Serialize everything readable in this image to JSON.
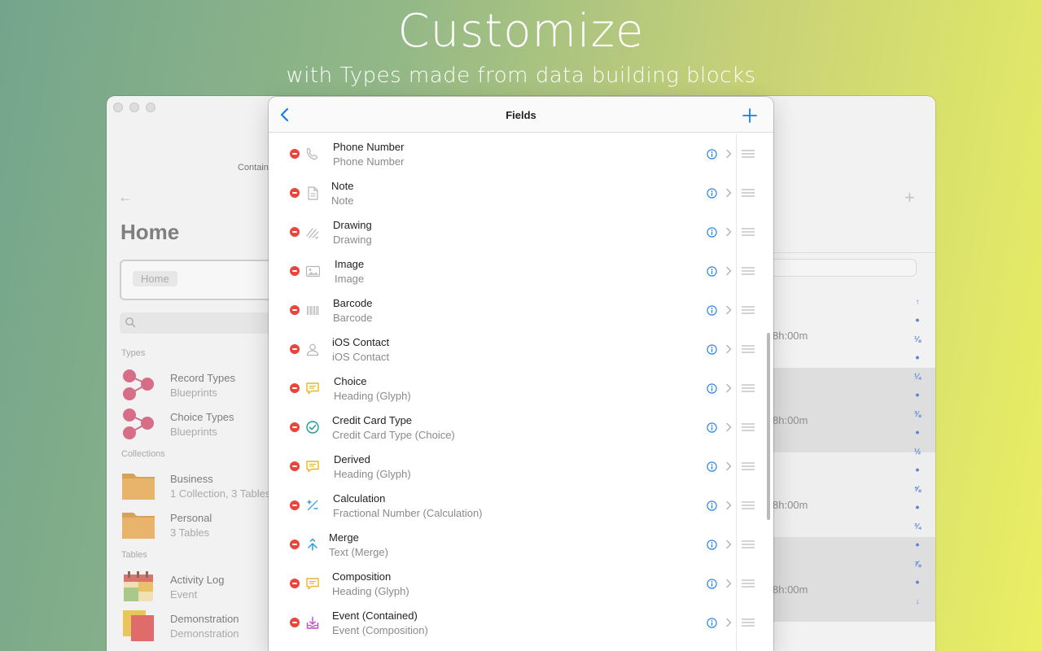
{
  "headline": "Customize",
  "subheadline": "with Types made from data building blocks",
  "background_window": {
    "toolbar_label": "Contain",
    "home_title": "Home",
    "home_chip": "Home",
    "sections": {
      "types": "Types",
      "collections": "Collections",
      "tables": "Tables"
    },
    "types": [
      {
        "title": "Record Types",
        "subtitle": "Blueprints"
      },
      {
        "title": "Choice Types",
        "subtitle": "Blueprints"
      }
    ],
    "collections": [
      {
        "title": "Business",
        "subtitle": "1 Collection, 3 Tables"
      },
      {
        "title": "Personal",
        "subtitle": "3 Tables"
      }
    ],
    "tables": [
      {
        "title": "Activity Log",
        "subtitle": "Event"
      },
      {
        "title": "Demonstration",
        "subtitle": "Demonstration"
      }
    ],
    "times": [
      "8h:00m",
      "8h:00m",
      "8h:00m",
      "8h:00m"
    ],
    "index_marks": [
      "↑",
      "•",
      "⅛",
      "•",
      "¼",
      "•",
      "⅜",
      "•",
      "½",
      "•",
      "⅝",
      "•",
      "¾",
      "•",
      "⅞",
      "•",
      "↓"
    ]
  },
  "sheet": {
    "title": "Fields",
    "fields": [
      {
        "name": "Phone Number",
        "type": "Phone Number",
        "icon": "phone-icon"
      },
      {
        "name": "Note",
        "type": "Note",
        "icon": "note-icon"
      },
      {
        "name": "Drawing",
        "type": "Drawing",
        "icon": "drawing-icon"
      },
      {
        "name": "Image",
        "type": "Image",
        "icon": "image-icon"
      },
      {
        "name": "Barcode",
        "type": "Barcode",
        "icon": "barcode-icon"
      },
      {
        "name": "iOS Contact",
        "type": "iOS Contact",
        "icon": "contact-icon"
      },
      {
        "name": "Choice",
        "type": "Heading (Glyph)",
        "icon": "speech-bubble-icon"
      },
      {
        "name": "Credit Card Type",
        "type": "Credit Card Type (Choice)",
        "icon": "checkmark-circle-icon"
      },
      {
        "name": "Derived",
        "type": "Heading (Glyph)",
        "icon": "speech-bubble-icon"
      },
      {
        "name": "Calculation",
        "type": "Fractional Number (Calculation)",
        "icon": "calculation-icon"
      },
      {
        "name": "Merge",
        "type": "Text (Merge)",
        "icon": "merge-icon"
      },
      {
        "name": "Composition",
        "type": "Heading (Glyph)",
        "icon": "speech-bubble-icon"
      },
      {
        "name": "Event (Contained)",
        "type": "Event (Composition)",
        "icon": "tray-download-icon"
      }
    ]
  },
  "colors": {
    "accent": "#1a7ee6",
    "delete": "#e8453c",
    "glyph_yellow": "#e9b52c",
    "glyph_teal": "#1d9a9a",
    "glyph_blue": "#2a9de0",
    "glyph_purple": "#c04fc8"
  }
}
